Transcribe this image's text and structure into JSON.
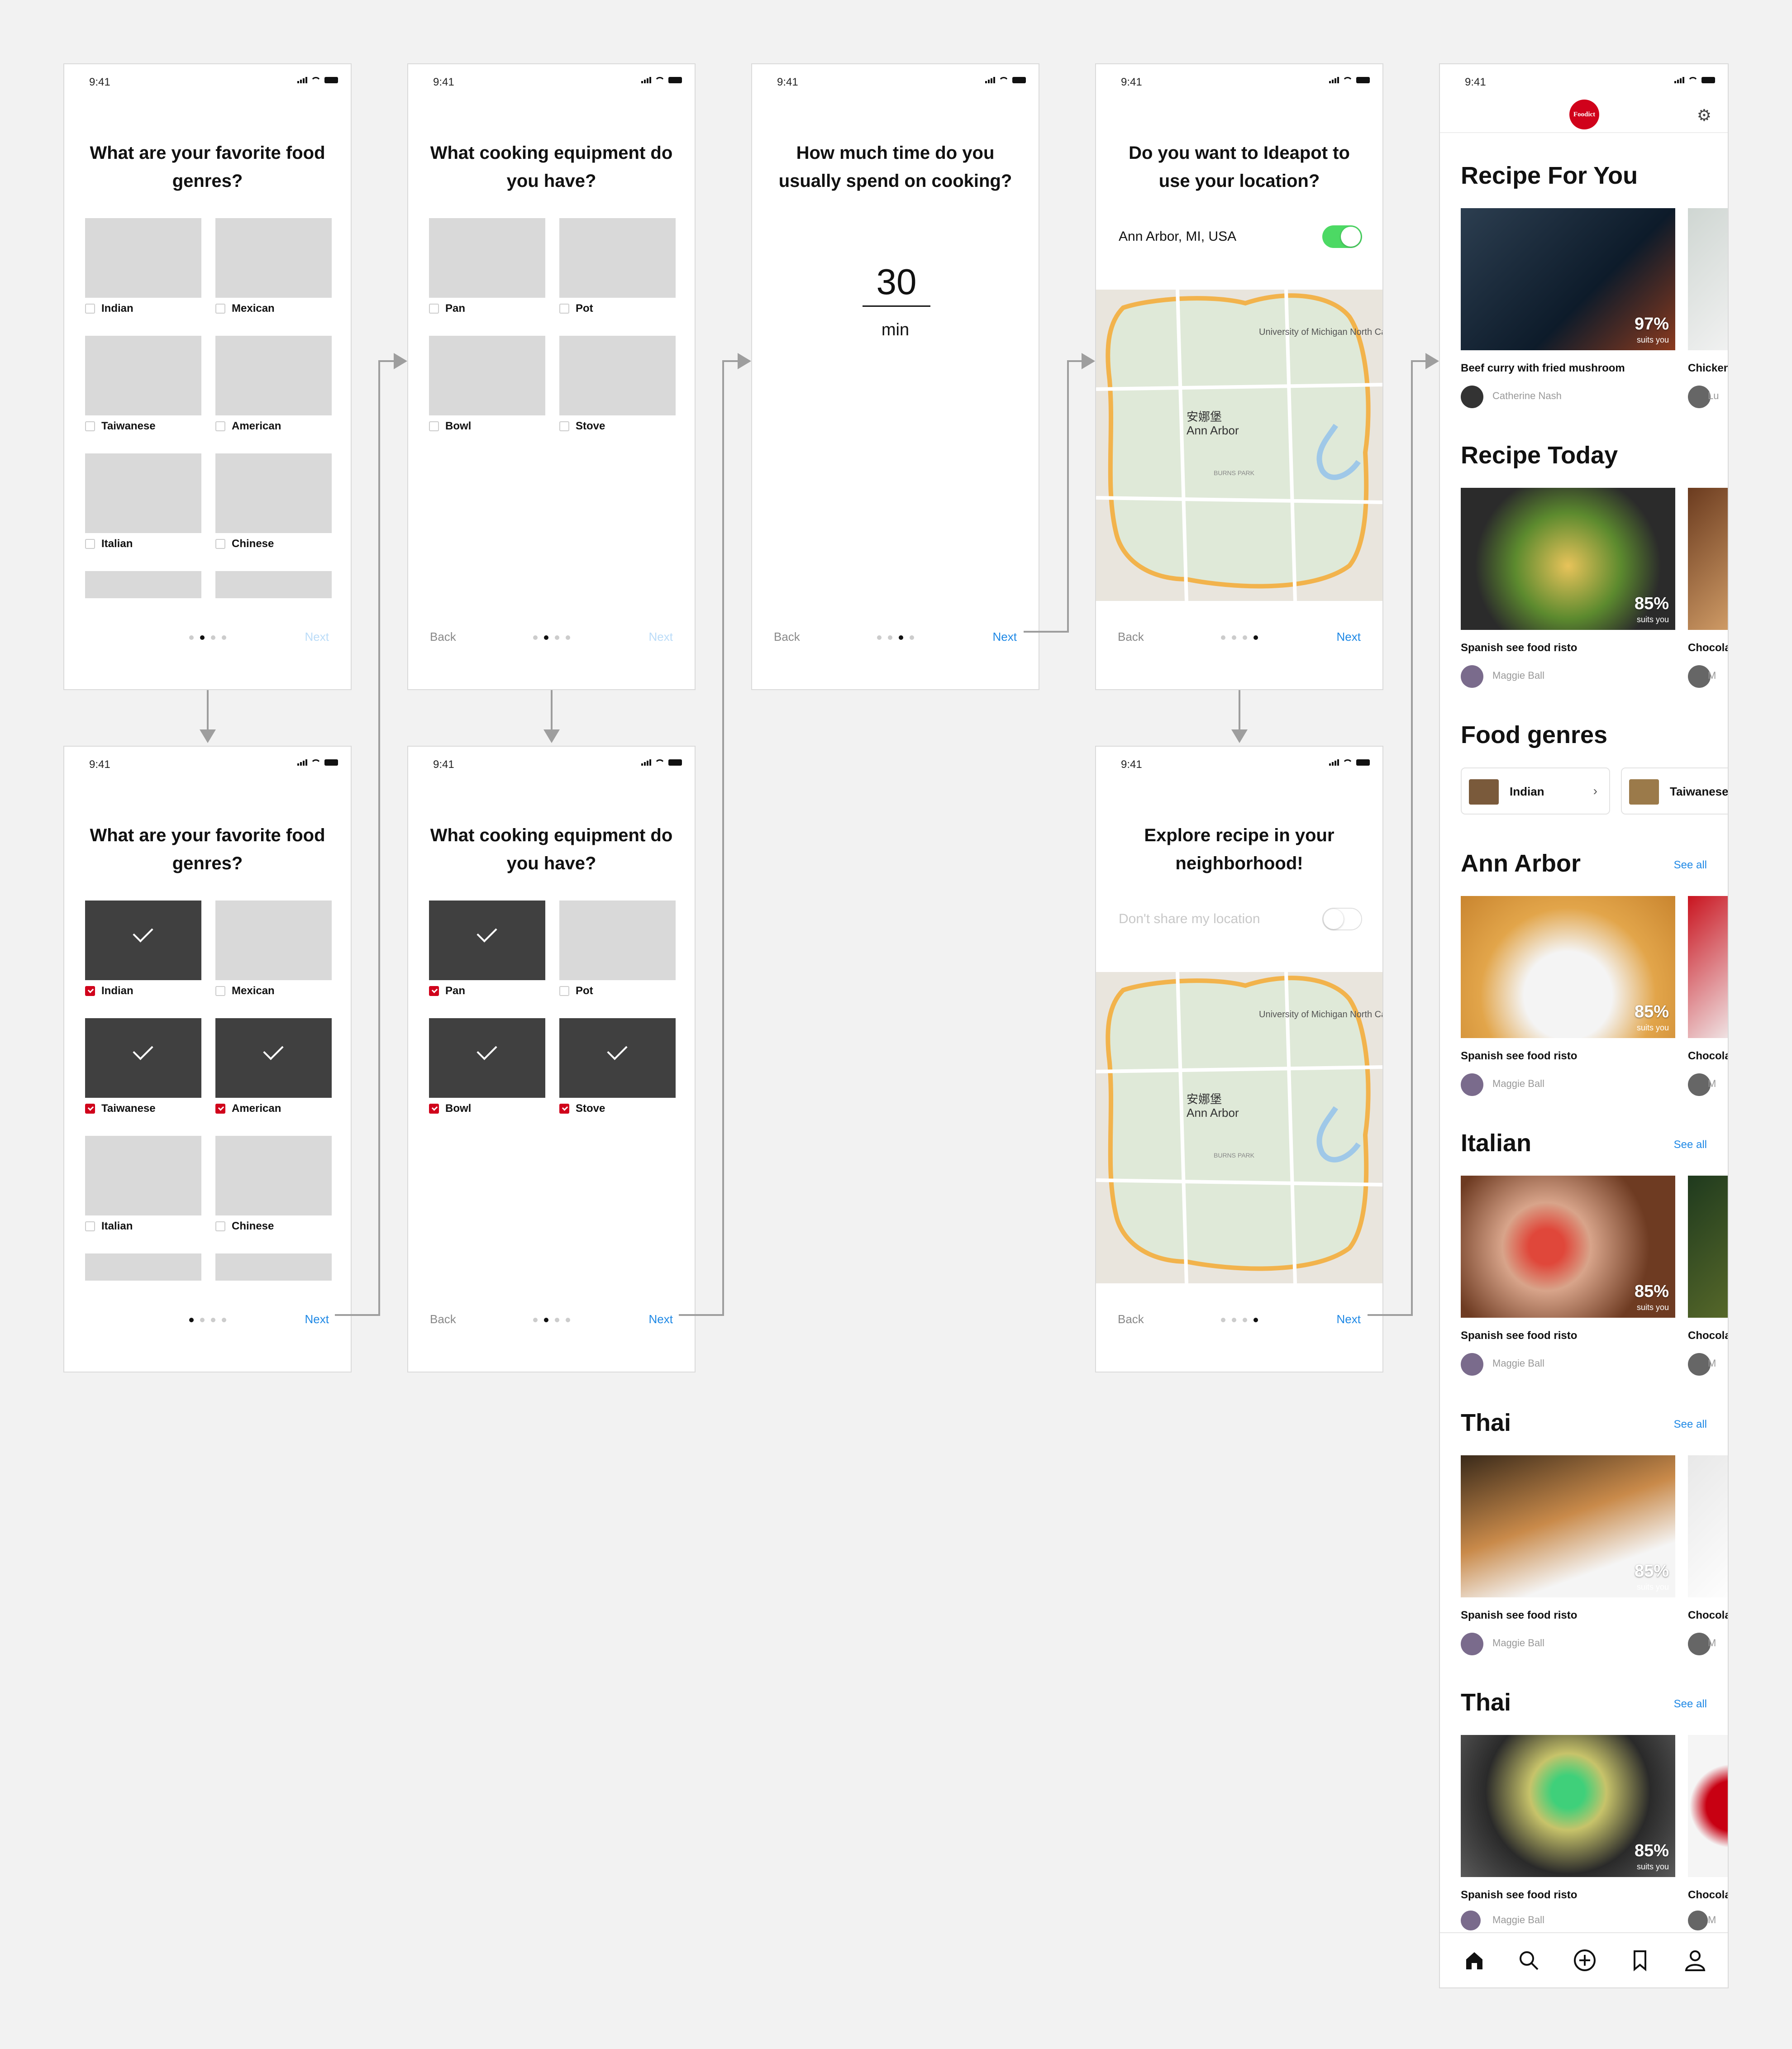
{
  "status_time": "9:41",
  "genres_screen": {
    "title": "What are your favorite food genres?",
    "items": [
      "Indian",
      "Mexican",
      "Taiwanese",
      "American",
      "Italian",
      "Chinese"
    ],
    "next": "Next"
  },
  "equipment_screen": {
    "title": "What cooking equipment do you have?",
    "items": [
      "Pan",
      "Pot",
      "Bowl",
      "Stove"
    ],
    "back": "Back",
    "next": "Next"
  },
  "time_screen": {
    "title": "How much time do you usually spend on cooking?",
    "value": "30",
    "unit": "min",
    "back": "Back",
    "next": "Next"
  },
  "location_screen": {
    "title": "Do you want to Ideapot to use your location?",
    "location": "Ann Arbor, MI, USA",
    "map_labels": [
      "University of Michigan North Campus",
      "安娜堡",
      "Ann Arbor",
      "BURNS PARK"
    ],
    "back": "Back",
    "next": "Next"
  },
  "explore_screen": {
    "title": "Explore recipe in your neighborhood!",
    "toggle_label": "Don't share my location",
    "back": "Back",
    "next": "Next"
  },
  "home": {
    "logo": "Foodict",
    "sections": [
      {
        "title": "Recipe For You",
        "see_all": "",
        "pct": "97%",
        "suits": "suits you",
        "name": "Beef curry with fried mushroom",
        "author": "Catherine Nash",
        "name2": "Chicken",
        "author2": "Lu"
      },
      {
        "title": "Recipe Today",
        "see_all": "",
        "pct": "85%",
        "suits": "suits you",
        "name": "Spanish see food risto",
        "author": "Maggie Ball",
        "name2": "Chocola",
        "author2": "M"
      },
      {
        "title": "Ann Arbor",
        "see_all": "See all",
        "pct": "85%",
        "suits": "suits you",
        "name": "Spanish see food risto",
        "author": "Maggie Ball",
        "name2": "Chocola",
        "author2": "M"
      },
      {
        "title": "Italian",
        "see_all": "See all",
        "pct": "85%",
        "suits": "suits you",
        "name": "Spanish see food risto",
        "author": "Maggie Ball",
        "name2": "Chocola",
        "author2": "M"
      },
      {
        "title": "Thai",
        "see_all": "See all",
        "pct": "85%",
        "suits": "suits you",
        "name": "Spanish see food risto",
        "author": "Maggie Ball",
        "name2": "Chocola",
        "author2": "M"
      },
      {
        "title": "Thai",
        "see_all": "See all",
        "pct": "85%",
        "suits": "suits you",
        "name": "Spanish see food risto",
        "author": "Maggie Ball",
        "name2": "Chocola",
        "author2": "M"
      }
    ],
    "food_genres_title": "Food genres",
    "genre_buttons": [
      "Indian",
      "Taiwanese"
    ]
  },
  "colors": {
    "accent": "#1e88e5",
    "checkbox": "#d0021b",
    "toggle_on": "#4cd964",
    "logo": "#d0021b"
  }
}
